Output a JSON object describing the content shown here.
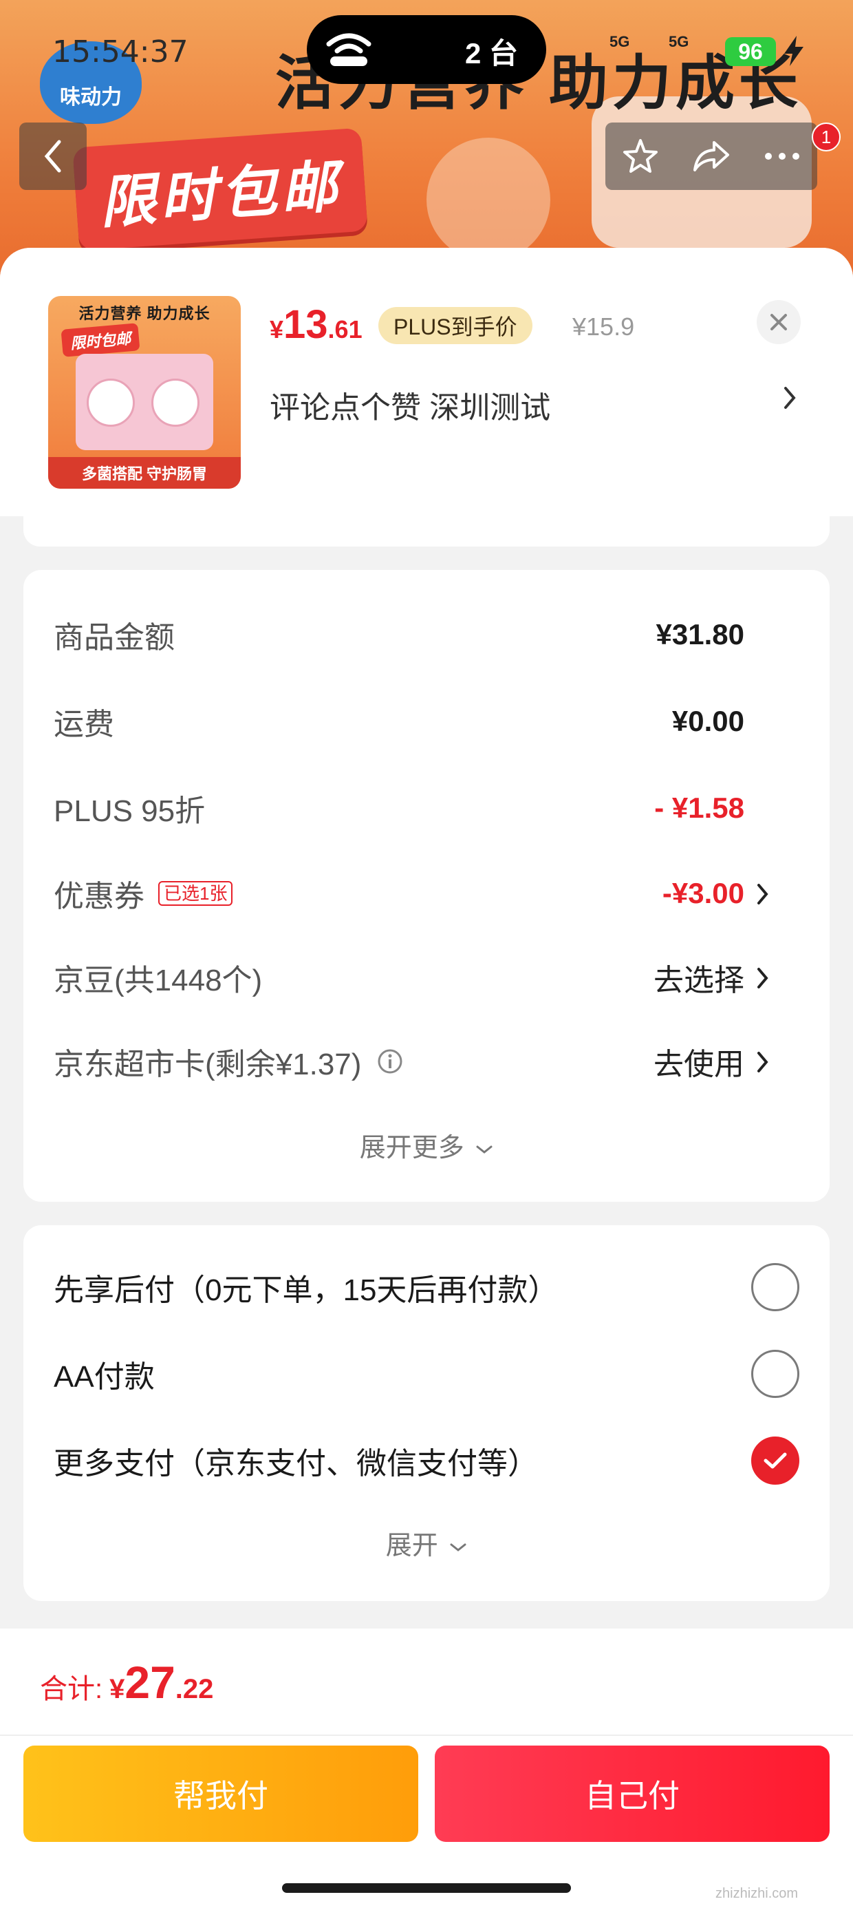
{
  "status_bar": {
    "time": "15:54:37",
    "island_text": "2 台",
    "net_left": "5G",
    "net_right": "5G",
    "battery": "96"
  },
  "background": {
    "banner_title": "活力营养 助力成长",
    "brand_logo": "味动力",
    "promo": "限时包邮"
  },
  "product": {
    "thumb_top": "活力营养 助力成长",
    "thumb_promo": "限时包邮",
    "thumb_bottom": "多菌搭配 守护肠胃",
    "price_symbol": "¥",
    "price_int": "13",
    "price_dec": ".61",
    "plus_tag": "PLUS到手价",
    "orig_price": "¥15.9",
    "spec": "评论点个赞  深圳测试"
  },
  "costs": {
    "goods_label": "商品金额",
    "goods_value": "¥31.80",
    "freight_label": "运费",
    "freight_value": "¥0.00",
    "plus_label": "PLUS 95折",
    "plus_value": "- ¥1.58",
    "coupon_label": "优惠券",
    "coupon_tag": "已选1张",
    "coupon_value": "-¥3.00",
    "jingdou_label": "京豆(共1448个)",
    "jingdou_value": "去选择",
    "card_label": "京东超市卡(剩余¥1.37)",
    "card_value": "去使用",
    "expand_more": "展开更多"
  },
  "payment": {
    "options": [
      {
        "label": "先享后付（0元下单，15天后再付款）",
        "checked": false
      },
      {
        "label": "AA付款",
        "checked": false
      },
      {
        "label": "更多支付（京东支付、微信支付等）",
        "checked": true
      }
    ],
    "expand": "展开"
  },
  "footer": {
    "total_label": "合计:",
    "total_symbol": "¥",
    "total_int": "27",
    "total_dec": ".22",
    "help_button": "帮我付",
    "self_button": "自己付"
  },
  "watermark": "zhizhizhi.com",
  "colors": {
    "accent_red": "#e8212a",
    "help_yellow": "#ffb214",
    "self_red": "#ff2a40",
    "plus_gold": "#f8e6b2"
  }
}
